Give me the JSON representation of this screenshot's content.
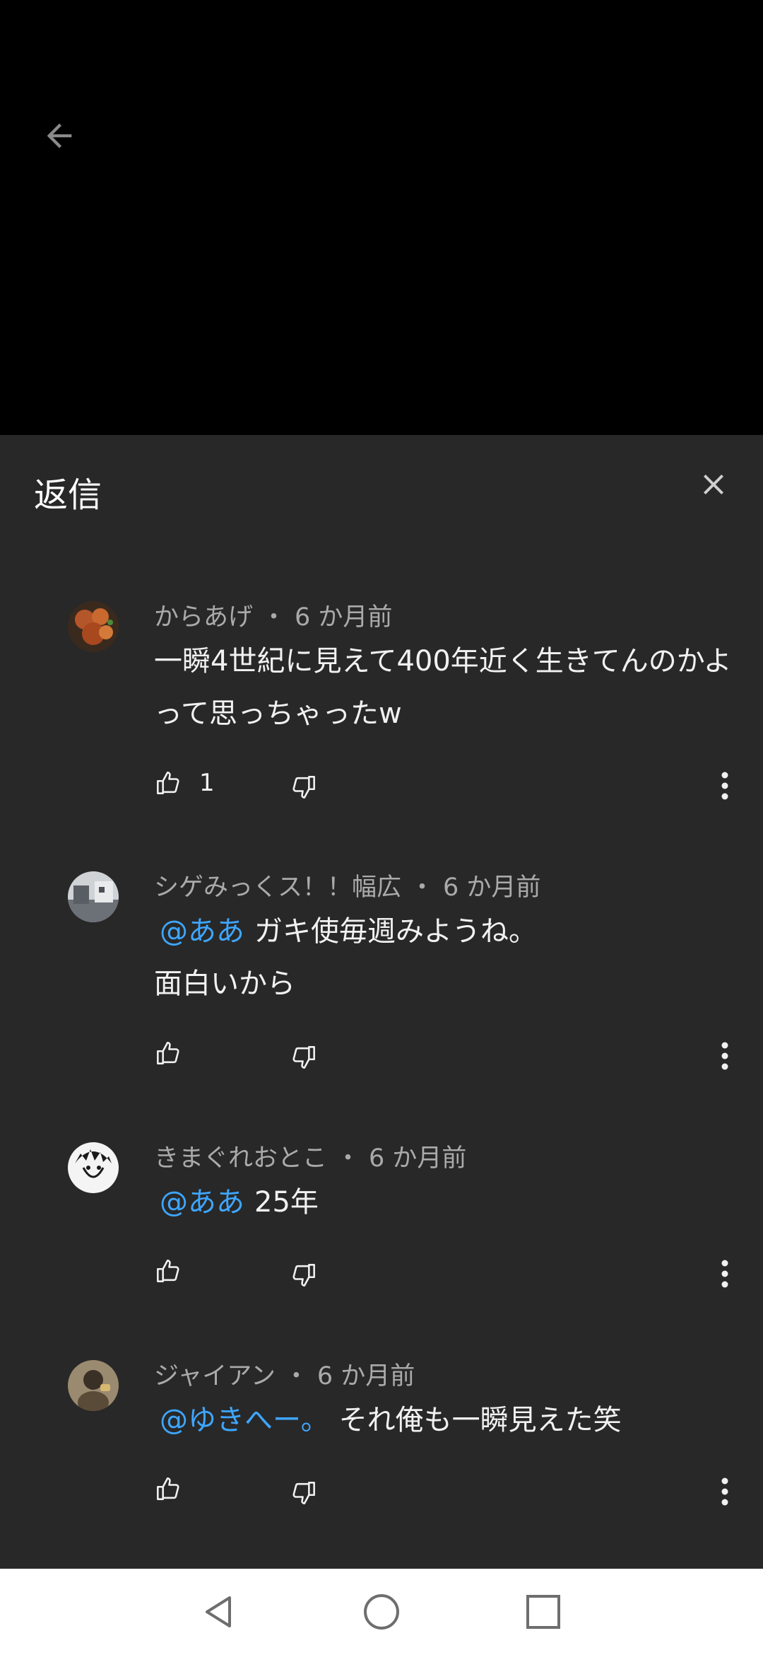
{
  "panel": {
    "title": "返信"
  },
  "comments": [
    {
      "author": "からあげ",
      "time": "6 か月前",
      "mention": "",
      "text": "一瞬4世紀に見えて400年近く生きてんのかよって思っちゃったw",
      "likes": "1",
      "avatar_color": "#b5562a"
    },
    {
      "author": "シゲみっくス！！幅広",
      "time": "6 か月前",
      "mention": "@ああ",
      "text": "ガキ使毎週みようね。\n面白いから",
      "likes": "",
      "avatar_color": "#8a9199"
    },
    {
      "author": "きまぐれおとこ",
      "time": "6 か月前",
      "mention": "@ああ",
      "text": "25年",
      "likes": "",
      "avatar_color": "#f2f2f2"
    },
    {
      "author": "ジャイアン",
      "time": "6 か月前",
      "mention": "@ゆきへー。",
      "text": "それ俺も一瞬見えた笑",
      "likes": "",
      "avatar_color": "#7d6b52"
    }
  ],
  "colors": {
    "background": "#282828",
    "mention": "#3ea6ff",
    "meta_text": "#aaaaaa",
    "body_text": "#f1f1f1"
  },
  "icons": {
    "back": "arrow-left-icon",
    "close": "close-icon",
    "like": "thumb-up-icon",
    "dislike": "thumb-down-icon",
    "more": "more-vert-icon",
    "nav_back": "triangle-back-icon",
    "nav_home": "circle-home-icon",
    "nav_recents": "square-recents-icon"
  }
}
